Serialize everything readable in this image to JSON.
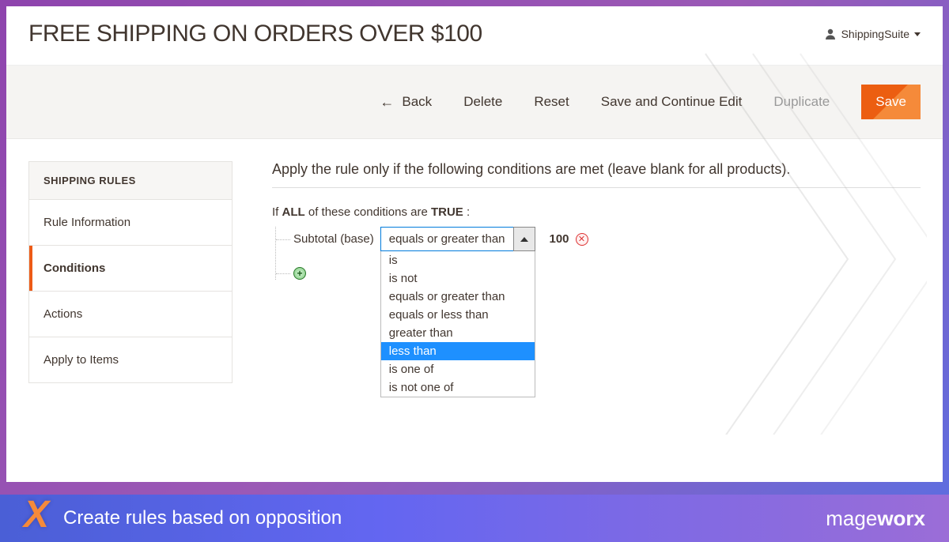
{
  "header": {
    "title": "FREE SHIPPING ON ORDERS OVER $100",
    "user_name": "ShippingSuite"
  },
  "toolbar": {
    "back": "Back",
    "delete": "Delete",
    "reset": "Reset",
    "save_continue": "Save and Continue Edit",
    "duplicate": "Duplicate",
    "save": "Save"
  },
  "sidebar": {
    "header": "SHIPPING RULES",
    "items": [
      {
        "label": "Rule Information"
      },
      {
        "label": "Conditions"
      },
      {
        "label": "Actions"
      },
      {
        "label": "Apply to Items"
      }
    ],
    "active_index": 1
  },
  "conditions": {
    "heading": "Apply the rule only if the following conditions are met (leave blank for all products).",
    "prefix_if": "If ",
    "aggregator": "ALL",
    "prefix_mid": "  of these conditions are ",
    "bool_value": "TRUE",
    "suffix": " :",
    "row": {
      "attribute": "Subtotal (base)",
      "selected_operator": "equals or greater than",
      "value": "100"
    },
    "operators": [
      "is",
      "is not",
      "equals or greater than",
      "equals or less than",
      "greater than",
      "less than",
      "is one of",
      "is not one of"
    ],
    "highlighted_operator": "less than"
  },
  "footer": {
    "caption": "Create rules based on opposition",
    "brand_light": "mage",
    "brand_bold": "worx"
  }
}
